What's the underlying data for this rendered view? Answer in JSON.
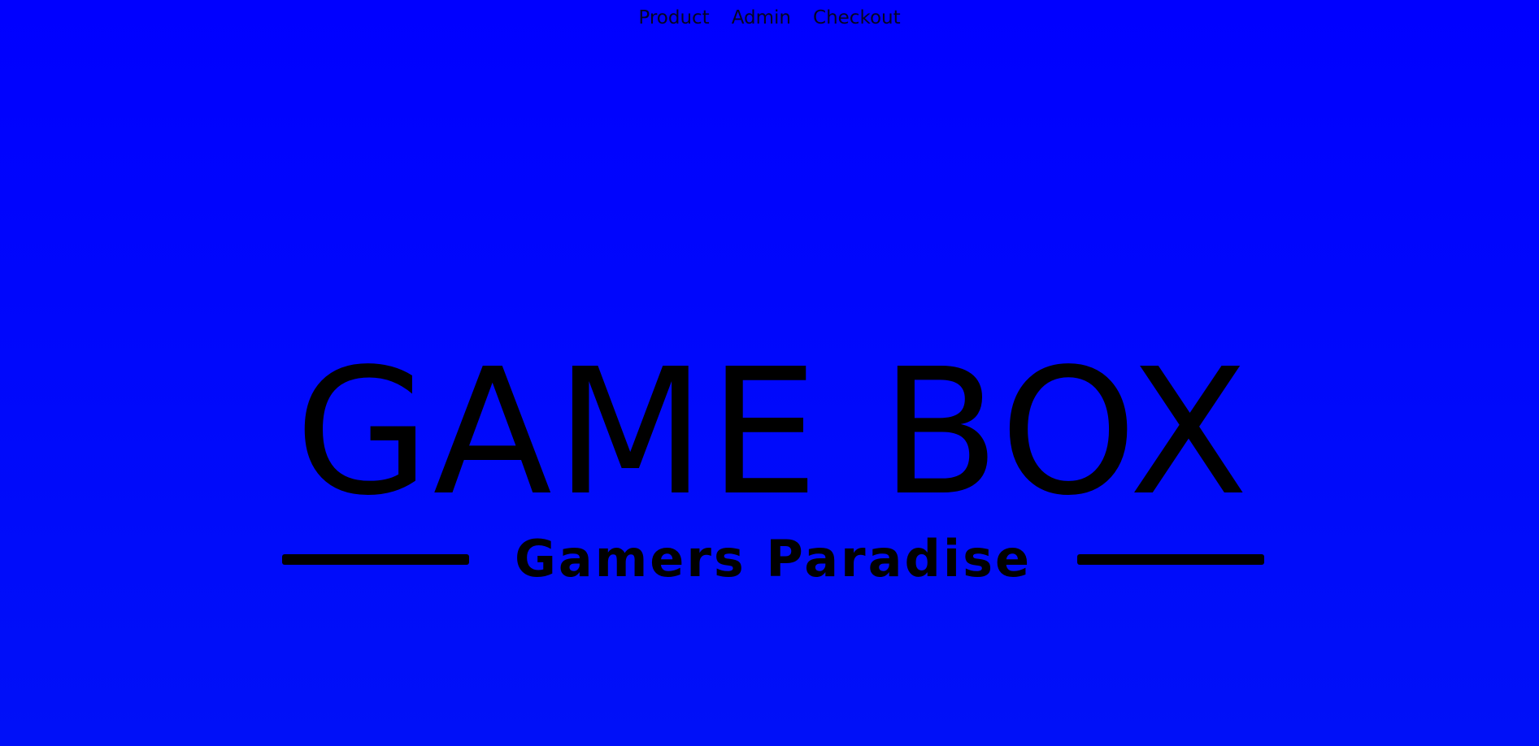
{
  "nav": {
    "items": [
      {
        "label": "Product"
      },
      {
        "label": "Admin"
      },
      {
        "label": "Checkout"
      }
    ]
  },
  "logo": {
    "title": "GAME BOX",
    "subtitle": "Gamers Paradise"
  },
  "colors": {
    "background": "#0000ff",
    "text": "#000000"
  }
}
